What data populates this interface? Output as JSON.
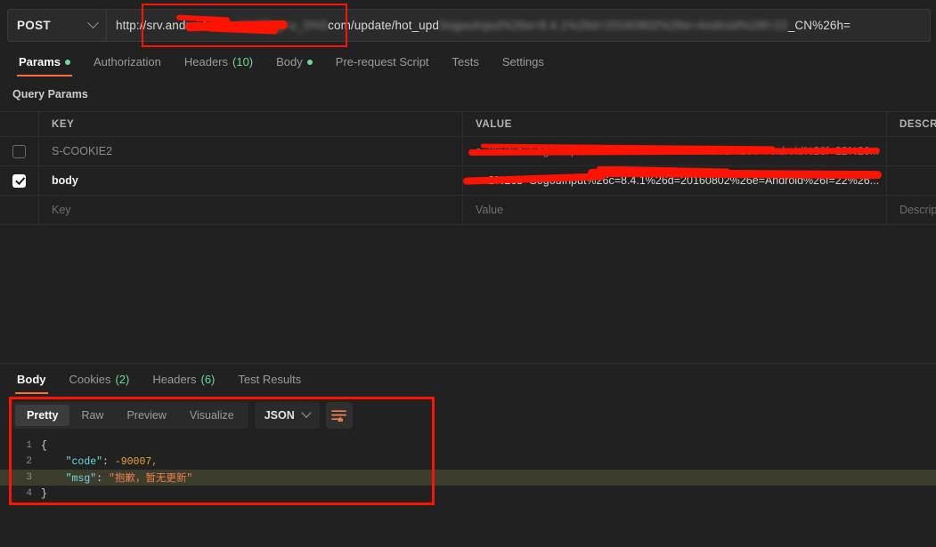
{
  "request": {
    "method": "POST",
    "url_visible_prefix": "http://srv.android.s",
    "url_visible_mid": "com/update/hot_upd",
    "url_blurred_1": "ate.php?flag=u_0%5",
    "url_blurred_2": "SogouInput%26a=8.4.1%26d=20160802%26e=Android%26f=22",
    "url_visible_suffix": "_CN%26h=",
    "method_caret_icon": "chevron-down-icon"
  },
  "request_tabs": [
    {
      "label": "Params",
      "badge": "",
      "dot": true,
      "active": true
    },
    {
      "label": "Authorization",
      "badge": "",
      "dot": false,
      "active": false
    },
    {
      "label": "Headers",
      "badge": "(10)",
      "dot": false,
      "active": false
    },
    {
      "label": "Body",
      "badge": "",
      "dot": true,
      "active": false
    },
    {
      "label": "Pre-request Script",
      "badge": "",
      "dot": false,
      "active": false
    },
    {
      "label": "Tests",
      "badge": "",
      "dot": false,
      "active": false
    },
    {
      "label": "Settings",
      "badge": "",
      "dot": false,
      "active": false
    }
  ],
  "query_params": {
    "section_title": "Query Params",
    "columns": {
      "key": "KEY",
      "value": "VALUE",
      "description": "DESCRI"
    },
    "rows": [
      {
        "checked": false,
        "key": "S-COOKIE2",
        "value": "a=2%26b=SogouInput%26c=8.4.1%26d=20160802%26e=Android%26f=22%26...",
        "description": ""
      },
      {
        "checked": true,
        "key": "body",
        "value": "a=2%26b=SogouInput%26c=8.4.1%26d=20160802%26e=Android%26f=22%26...",
        "description": ""
      }
    ],
    "placeholder_row": {
      "key": "Key",
      "value": "Value",
      "description": "Descrip"
    }
  },
  "response_tabs": [
    {
      "label": "Body",
      "badge": "",
      "active": true
    },
    {
      "label": "Cookies",
      "badge": "(2)",
      "active": false
    },
    {
      "label": "Headers",
      "badge": "(6)",
      "active": false
    },
    {
      "label": "Test Results",
      "badge": "",
      "active": false
    }
  ],
  "response_viewer": {
    "modes": [
      {
        "label": "Pretty",
        "active": true
      },
      {
        "label": "Raw",
        "active": false
      },
      {
        "label": "Preview",
        "active": false
      },
      {
        "label": "Visualize",
        "active": false
      }
    ],
    "format": "JSON",
    "format_caret_icon": "chevron-down-icon",
    "wrap_icon": "wrap-text-icon"
  },
  "response_body": {
    "lines": [
      {
        "n": "1",
        "tokens": [
          {
            "t": "brace",
            "v": "{"
          }
        ],
        "highlight": false
      },
      {
        "n": "2",
        "tokens": [
          {
            "t": "plain",
            "v": "    "
          },
          {
            "t": "key",
            "v": "\"code\""
          },
          {
            "t": "punc",
            "v": ":"
          },
          {
            "t": "plain",
            "v": " "
          },
          {
            "t": "num",
            "v": "-90007"
          },
          {
            "t": "comma",
            "v": ","
          }
        ],
        "highlight": false
      },
      {
        "n": "3",
        "tokens": [
          {
            "t": "plain",
            "v": "    "
          },
          {
            "t": "key",
            "v": "\"msg\""
          },
          {
            "t": "punc",
            "v": ":"
          },
          {
            "t": "plain",
            "v": " "
          },
          {
            "t": "str",
            "v": "\"抱歉，暂无更新\""
          }
        ],
        "highlight": true
      },
      {
        "n": "4",
        "tokens": [
          {
            "t": "brace",
            "v": "}"
          }
        ],
        "highlight": false
      }
    ]
  },
  "annotations": {
    "accent_red": "#fc1302",
    "accent_orange": "#ff6c37",
    "accent_green": "#6bdb92"
  }
}
